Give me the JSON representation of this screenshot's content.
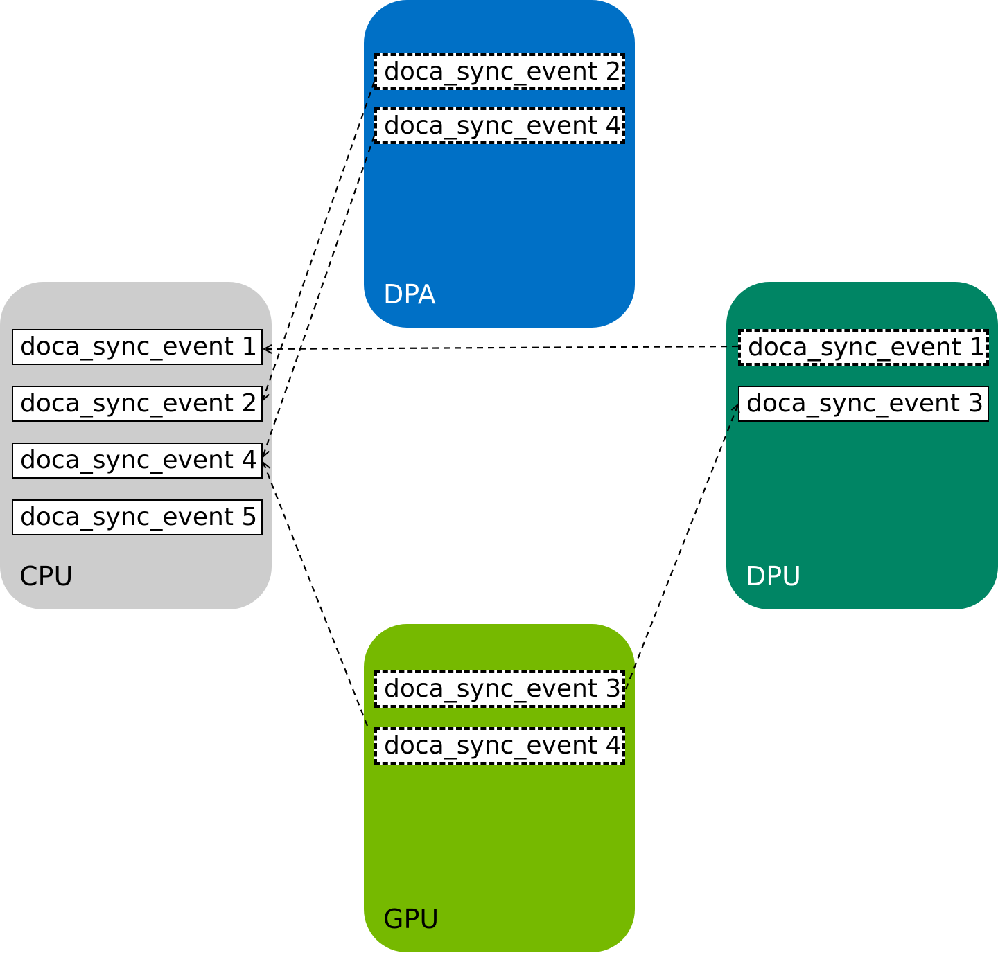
{
  "colors": {
    "dpa": "#0070C6",
    "cpu": "#CDCDCD",
    "dpu": "#008564",
    "gpu": "#76B900"
  },
  "nodes": {
    "dpa": {
      "label": "DPA",
      "events": [
        "doca_sync_event 2",
        "doca_sync_event 4"
      ]
    },
    "cpu": {
      "label": "CPU",
      "events": [
        "doca_sync_event 1",
        "doca_sync_event 2",
        "doca_sync_event 4",
        "doca_sync_event 5"
      ]
    },
    "dpu": {
      "label": "DPU",
      "events": [
        "doca_sync_event 1",
        "doca_sync_event 3"
      ]
    },
    "gpu": {
      "label": "GPU",
      "events": [
        "doca_sync_event 3",
        "doca_sync_event 4"
      ]
    }
  },
  "connections": [
    {
      "from": "DPU doca_sync_event 1",
      "to": "CPU doca_sync_event 1",
      "style": "dashed-arrow"
    },
    {
      "from": "DPA doca_sync_event 2",
      "to": "CPU doca_sync_event 2",
      "style": "dashed-arrow"
    },
    {
      "from": "DPA doca_sync_event 4",
      "to": "CPU doca_sync_event 4",
      "style": "dashed-arrow"
    },
    {
      "from": "GPU doca_sync_event 4",
      "to": "CPU doca_sync_event 4",
      "style": "dashed-arrow"
    },
    {
      "from": "GPU doca_sync_event 3",
      "to": "DPU doca_sync_event 3",
      "style": "dashed-arrow"
    }
  ]
}
